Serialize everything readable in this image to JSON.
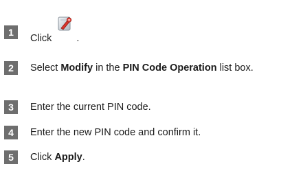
{
  "steps": [
    {
      "number": "1",
      "text_before": "Click",
      "icon": "pin-settings-icon",
      "text_after": "."
    },
    {
      "number": "2",
      "t1": "Select ",
      "b1": "Modify",
      "t2": " in the ",
      "b2": "PIN Code Operation",
      "t3": " list box."
    },
    {
      "number": "3",
      "text": "Enter the current PIN code."
    },
    {
      "number": "4",
      "text": "Enter the new PIN code and confirm it."
    },
    {
      "number": "5",
      "t1": "Click ",
      "b1": "Apply",
      "t2": "."
    }
  ]
}
